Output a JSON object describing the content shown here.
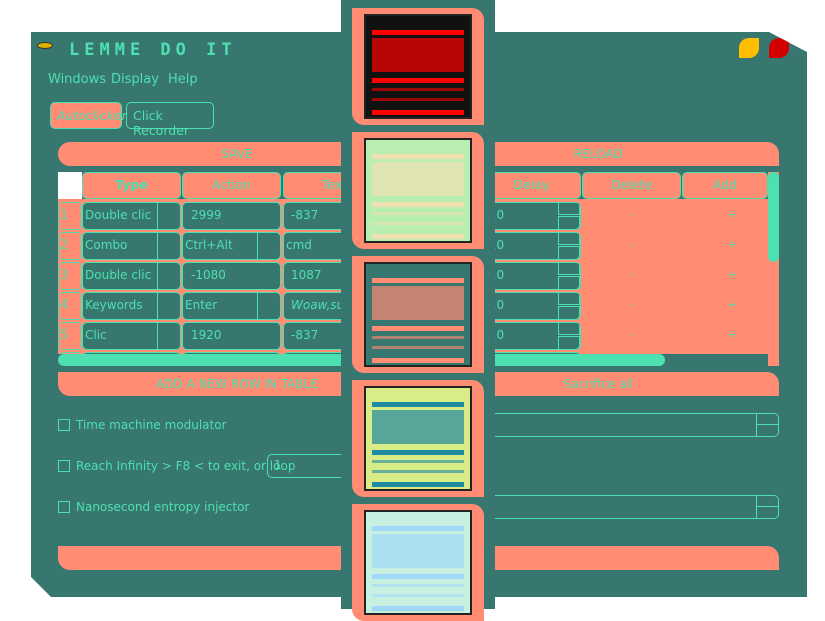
{
  "app": {
    "title": "LEMME DO IT",
    "colors": {
      "bg": "#387670",
      "accent": "#ff8c73",
      "mint": "#4de0b0",
      "minimize": "#ffbf00",
      "close": "#d40000"
    }
  },
  "menu": [
    "Windows",
    "Display",
    "Help"
  ],
  "tabs": [
    {
      "label": "Autoclicker",
      "active": true
    },
    {
      "label": "Click Recorder",
      "active": false
    }
  ],
  "actions": {
    "save": "SAVE",
    "reload": "RELOAD",
    "add_row": "ADD A NEW ROW IN TABLE",
    "sacrifice": "Sacrifice all"
  },
  "table": {
    "headers": [
      "Type",
      "Action",
      "Text",
      "Delay",
      "Delete",
      "Add"
    ],
    "header_text_visible": "Tex",
    "rows": [
      {
        "index": "1",
        "type": "Double clic",
        "action": "2999",
        "text": "-837",
        "delay": ",10",
        "delete": "-",
        "add": "+"
      },
      {
        "index": "2",
        "type": "Combo",
        "action": "Ctrl+Alt",
        "text": "cmd",
        "delay": ",10",
        "delete": "-",
        "add": "+"
      },
      {
        "index": "3",
        "type": "Double clic",
        "action": "-1080",
        "text": "1087",
        "delay": ",10",
        "delete": "-",
        "add": "+"
      },
      {
        "index": "4",
        "type": "Keywords",
        "action": "Enter",
        "text": "Woaw,such",
        "delay": ",10",
        "delete": "-",
        "add": "+"
      },
      {
        "index": "5",
        "type": "Clic",
        "action": "1920",
        "text": "-837",
        "delay": ",10",
        "delete": "-",
        "add": "+"
      }
    ]
  },
  "options": [
    {
      "label": "Time machine modulator",
      "checked": false
    },
    {
      "label": "Reach Infinity > F8 < to exit, or loop",
      "checked": false,
      "value": "1"
    },
    {
      "label": "Nanosecond entropy injector",
      "checked": false
    }
  ],
  "theme_previews": [
    {
      "name": "dark",
      "bg": "#111111",
      "accent": "#ff0000"
    },
    {
      "name": "light-green",
      "bg": "#b8eeb0",
      "accent": "#f0e0b0"
    },
    {
      "name": "teal",
      "bg": "#387670",
      "accent": "#ff8c73"
    },
    {
      "name": "lime",
      "bg": "#d8ec88",
      "accent": "#1f8aa0"
    },
    {
      "name": "mint",
      "bg": "#c8f0e0",
      "accent": "#a0d8f8"
    }
  ]
}
